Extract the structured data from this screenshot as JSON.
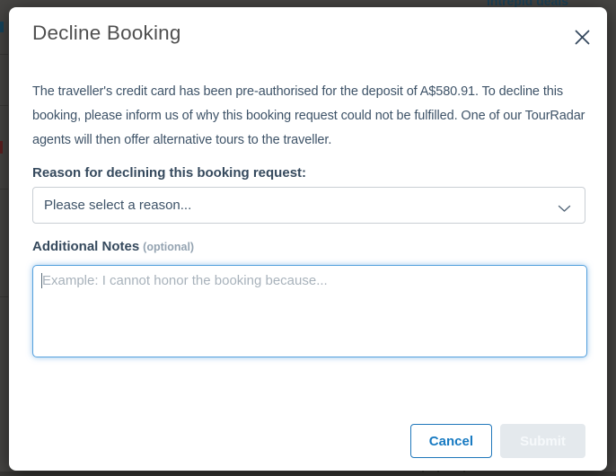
{
  "modal": {
    "title": "Decline Booking",
    "description": "The traveller's credit card has been pre-authorised for the deposit of A$580.91. To decline this booking, please inform us of why this booking request could not be fulfilled. One of our TourRadar agents will then offer alternative tours to the traveller.",
    "reason": {
      "label": "Reason for declining this booking request:",
      "selected_option": "Please select a reason..."
    },
    "notes": {
      "label": "Additional Notes",
      "optional_hint": "(optional)",
      "placeholder": "Example: I cannot honor the booking because...",
      "value": ""
    },
    "footer": {
      "cancel_label": "Cancel",
      "submit_label": "Submit"
    },
    "icons": {
      "close": "close-icon",
      "chevron": "chevron-down-icon"
    }
  },
  "background": {
    "partial_link_text": "Intrepid deals"
  },
  "colors": {
    "accent_blue": "#177ac2",
    "focus_border": "#55a1dd",
    "body_text_slate": "#3e5368",
    "label_dark": "#35495d",
    "title_gray": "#4f4f4f",
    "placeholder_gray": "#a8b2bb",
    "disabled_button_bg": "#e4e9ed",
    "overlay_gray": "#464543"
  }
}
